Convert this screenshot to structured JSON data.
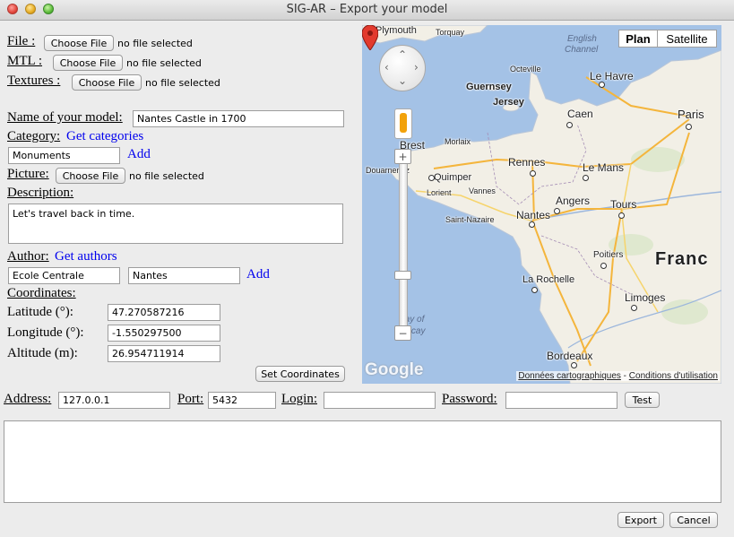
{
  "window": {
    "title": "SIG-AR – Export your model"
  },
  "files": {
    "file_label": "File :",
    "mtl_label": "MTL :",
    "textures_label": "Textures :",
    "choose_label": "Choose File",
    "no_file": "no file selected"
  },
  "model": {
    "name_label": "Name of your model:",
    "name_value": "Nantes Castle in 1700",
    "category_label": "Category:",
    "get_categories": "Get categories",
    "category_value": "Monuments",
    "add_label": "Add",
    "picture_label": "Picture:",
    "description_label": "Description:",
    "description_value": "Let's travel back in time.",
    "author_label": "Author:",
    "get_authors": "Get authors",
    "author_first": "Ecole Centrale",
    "author_second": "Nantes"
  },
  "coordinates": {
    "label": "Coordinates:",
    "latitude_label": "Latitude (°):",
    "latitude_value": "47.270587216",
    "longitude_label": "Longitude (°):",
    "longitude_value": "-1.550297500",
    "altitude_label": "Altitude (m):",
    "altitude_value": "26.954711914",
    "set_button": "Set Coordinates"
  },
  "map": {
    "plan": "Plan",
    "satellite": "Satellite",
    "zoom_in": "+",
    "zoom_out": "−",
    "logo": "Google",
    "attribution_data": "Données cartographiques",
    "attribution_sep": " - ",
    "attribution_terms": "Conditions d'utilisation",
    "labels": {
      "plymouth": "Plymouth",
      "torquay": "Torquay",
      "english_channel_1": "English",
      "english_channel_2": "Channel",
      "octeville": "Octeville",
      "le_havre": "Le Havre",
      "guernsey": "Guernsey",
      "jersey": "Jersey",
      "caen": "Caen",
      "paris": "Paris",
      "brest": "Brest",
      "morlaix": "Morlaix",
      "douarnenez": "Douarnenez",
      "quimper": "Quimper",
      "rennes": "Rennes",
      "le_mans": "Le Mans",
      "lorient": "Lorient",
      "vannes": "Vannes",
      "angers": "Angers",
      "tours": "Tours",
      "saint_nazaire": "Saint-Nazaire",
      "nantes": "Nantes",
      "france": "Franc",
      "poitiers": "Poitiers",
      "la_rochelle": "La Rochelle",
      "limoges": "Limoges",
      "bay_1": "Bay of",
      "bay_2": "Biscay",
      "bordeaux": "Bordeaux"
    }
  },
  "connection": {
    "address_label": "Address:",
    "address_value": "127.0.0.1",
    "port_label": "Port:",
    "port_value": "5432",
    "login_label": "Login:",
    "login_value": "",
    "password_label": "Password:",
    "password_value": "",
    "test_button": "Test"
  },
  "log": {
    "text": ""
  },
  "footer": {
    "export_button": "Export",
    "cancel_button": "Cancel"
  },
  "colors": {
    "link": "#0000ee",
    "sea": "#a4c2e6",
    "land": "#f2efe6",
    "pin": "#e23a2e"
  }
}
